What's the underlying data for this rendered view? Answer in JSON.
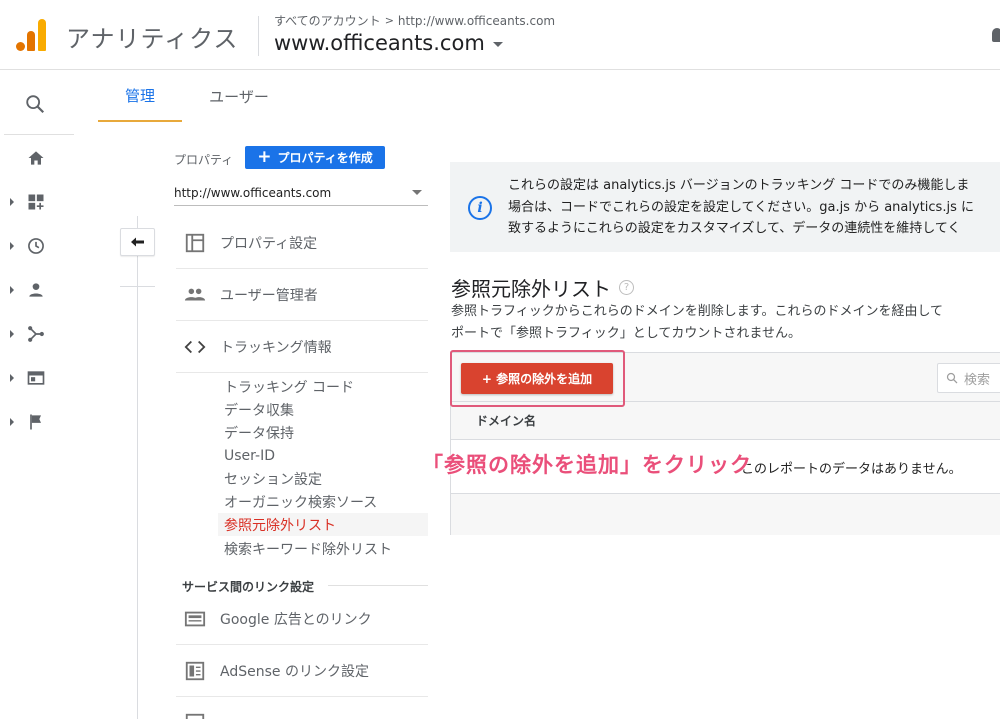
{
  "header": {
    "app_title": "アナリティクス",
    "breadcrumb_all": "すべてのアカウント",
    "breadcrumb_sep": ">",
    "breadcrumb_account": "http://www.officeants.com",
    "account_name": "www.officeants.com"
  },
  "tabs": [
    {
      "label": "管理",
      "active": true
    },
    {
      "label": "ユーザー",
      "active": false
    }
  ],
  "rail_icons": [
    "search-icon",
    "home-icon",
    "dashboard-icon",
    "clock-icon",
    "person-icon",
    "acquisition-icon",
    "display-icon",
    "flag-icon"
  ],
  "property": {
    "label": "プロパティ",
    "create_button": "プロパティを作成",
    "selected": "http://www.officeants.com"
  },
  "nav": {
    "property_settings": "プロパティ設定",
    "user_management": "ユーザー管理者",
    "tracking_info": "トラッキング情報",
    "sub_items": [
      "トラッキング コード",
      "データ収集",
      "データ保持",
      "User-ID",
      "セッション設定",
      "オーガニック検索ソース",
      "参照元除外リスト",
      "検索キーワード除外リスト"
    ],
    "active_sub_item": "参照元除外リスト",
    "section_heading": "サービス間のリンク設定",
    "google_ads_link": "Google 広告とのリンク",
    "adsense_link": "AdSense のリンク設定"
  },
  "info": {
    "line1": "これらの設定は analytics.js バージョンのトラッキング コードでのみ機能しま",
    "line2": "場合は、コードでこれらの設定を設定してください。ga.js から analytics.js に",
    "line3": "致するようにこれらの設定をカスタマイズして、データの連続性を維持してく"
  },
  "referral": {
    "title": "参照元除外リスト",
    "help": "?",
    "desc1": "参照トラフィックからこれらのドメインを削除します。これらのドメインを経由して",
    "desc2": "ポートで「参照トラフィック」としてカウントされません。",
    "add_button": "+ 参照の除外を追加",
    "search_placeholder": "検索",
    "column_header": "ドメイン名",
    "empty_message": "このレポートのデータはありません。"
  },
  "annotation": "「参照の除外を追加」をクリック",
  "colors": {
    "accent_blue": "#1a73e8",
    "add_button": "#d9432f",
    "active_link": "#d93025",
    "annotation": "#ea4f7a",
    "tab_underline": "#e8a93b"
  }
}
